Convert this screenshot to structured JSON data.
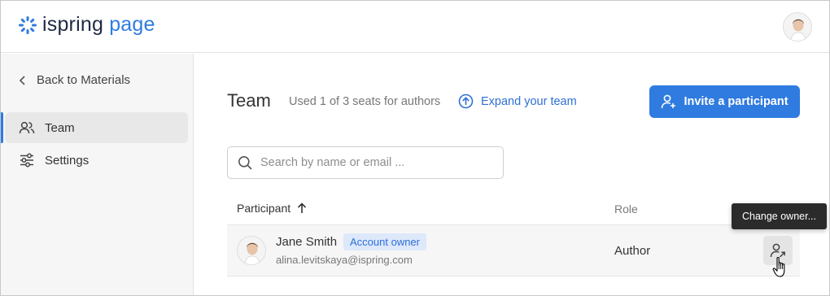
{
  "header": {
    "logo": {
      "part1": "ispring",
      "part2": "page",
      "icon": "ispring-logo-icon"
    },
    "user_avatar": "user-avatar"
  },
  "sidebar": {
    "back_label": "Back to Materials",
    "items": [
      {
        "label": "Team",
        "icon": "users-icon",
        "active": true
      },
      {
        "label": "Settings",
        "icon": "sliders-icon",
        "active": false
      }
    ]
  },
  "main": {
    "title": "Team",
    "seats_text": "Used 1 of 3 seats for authors",
    "expand_label": "Expand your team",
    "invite_label": "Invite a participant",
    "search_placeholder": "Search by name or email ...",
    "columns": {
      "participant": "Participant",
      "role": "Role"
    },
    "rows": [
      {
        "name": "Jane Smith",
        "badge": "Account owner",
        "email": "alina.levitskaya@ispring.com",
        "role": "Author"
      }
    ],
    "tooltip": "Change owner..."
  },
  "colors": {
    "accent": "#2f7be0",
    "badge_bg": "#dde8fb",
    "logo_dark": "#1f2a44"
  }
}
